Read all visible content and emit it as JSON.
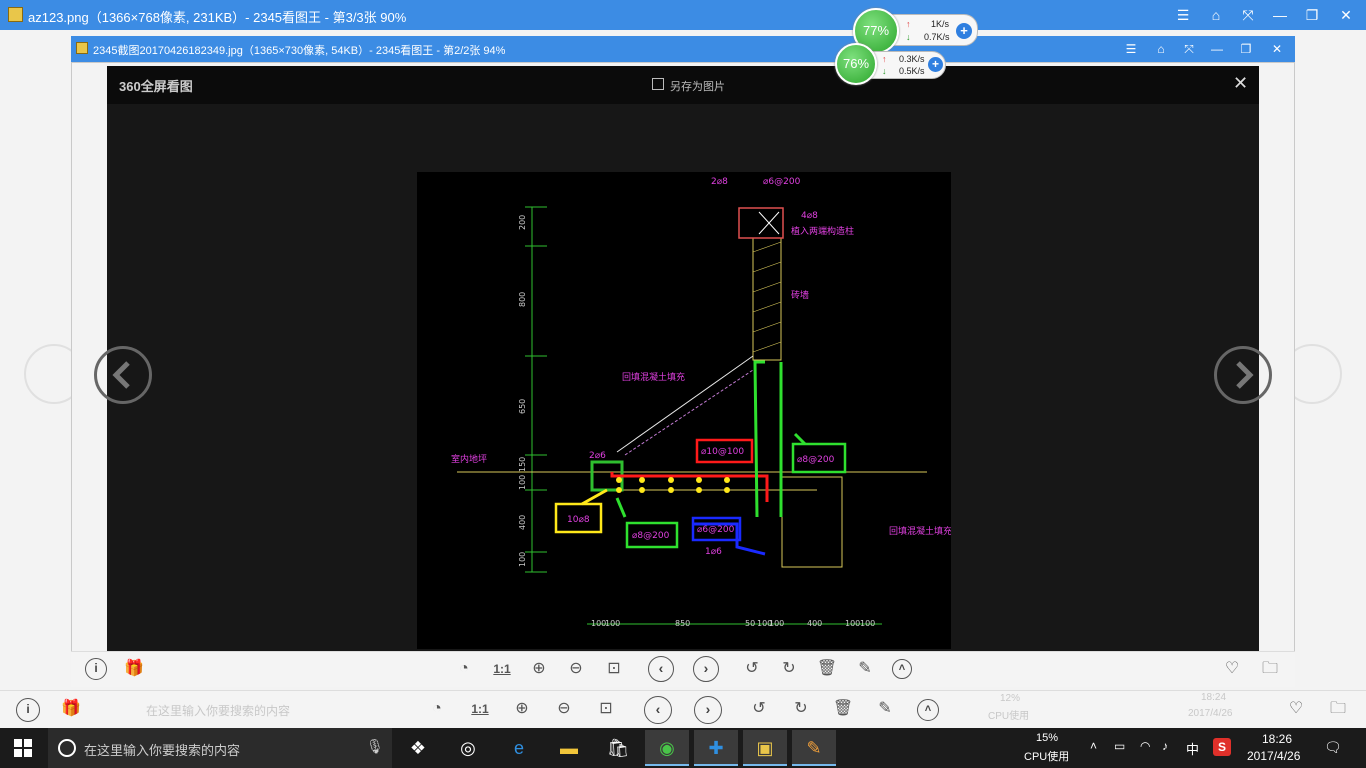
{
  "outer_window": {
    "title": "az123.png（1366×768像素, 231KB）- 2345看图王 - 第3/3张 90%",
    "controls": [
      "☰",
      "⌂",
      "⤧",
      "—",
      "❐",
      "✕"
    ]
  },
  "inner_window": {
    "title": "2345截图20170426182349.jpg（1365×730像素, 54KB）- 2345看图王 - 第2/2张 94%",
    "controls": [
      "☰",
      "⌂",
      "⤧",
      "—",
      "❐",
      "✕"
    ]
  },
  "viewer": {
    "brand": "360全屏看图",
    "save_label": "另存为图片",
    "close": "✕"
  },
  "net_widget_outer": {
    "percent": "77%",
    "up": "1K/s",
    "down": "0.7K/s"
  },
  "net_widget_inner": {
    "percent": "76%",
    "up": "0.3K/s",
    "down": "0.5K/s"
  },
  "drawing": {
    "texts": [
      "2⌀8",
      "⌀6@200",
      "4⌀8",
      "植入两端构造柱",
      "砖墙",
      "回填混凝土填充",
      "⌀10@100",
      "⌀8@200",
      "10⌀8",
      "⌀8@200",
      "⌀6@200",
      "1⌀6",
      "回填混凝土填充",
      "2⌀6",
      "室内地坪"
    ],
    "dims_left": [
      "200",
      "800",
      "650",
      "150",
      "100",
      "400",
      "100"
    ],
    "dims_bottom": [
      "100",
      "100",
      "850",
      "50",
      "100",
      "100",
      "400",
      "100",
      "100"
    ]
  },
  "inner_toolbar": {
    "ratio_label": "1:1"
  },
  "outer_toolbar": {
    "ratio_label": "1:1",
    "search_ghost": "在这里输入你要搜索的内容",
    "cpu_ghost": "12%",
    "cpu_label_ghost": "CPU使用",
    "time_ghost": "18:24",
    "date_ghost": "2017/4/26"
  },
  "taskbar": {
    "search_placeholder": "在这里输入你要搜索的内容",
    "cpu_percent": "15%",
    "cpu_label": "CPU使用",
    "ime": "中",
    "time": "18:26",
    "date": "2017/4/26"
  }
}
